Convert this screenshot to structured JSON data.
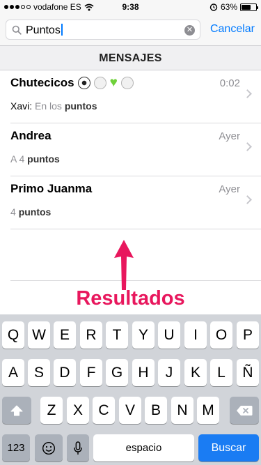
{
  "status_bar": {
    "carrier": "vodafone ES",
    "time": "9:38",
    "battery_percent": "63%",
    "battery_level": 0.63
  },
  "search": {
    "query": "Puntos",
    "cancel_label": "Cancelar"
  },
  "section": {
    "title": "MENSAJES"
  },
  "messages": [
    {
      "title": "Chutecicos",
      "time": "0:02",
      "sender": "Xavi:",
      "snippet_pre": "En los",
      "snippet_highlight": "puntos"
    },
    {
      "title": "Andrea",
      "time": "Ayer",
      "sender": "",
      "snippet_pre": "A 4",
      "snippet_highlight": "puntos"
    },
    {
      "title": "Primo Juanma",
      "time": "Ayer",
      "sender": "",
      "snippet_pre": "4",
      "snippet_highlight": "puntos"
    }
  ],
  "annotation": {
    "label": "Resultados",
    "color": "#e8175d"
  },
  "keyboard": {
    "row1": [
      "Q",
      "W",
      "E",
      "R",
      "T",
      "Y",
      "U",
      "I",
      "O",
      "P"
    ],
    "row2": [
      "A",
      "S",
      "D",
      "F",
      "G",
      "H",
      "J",
      "K",
      "L",
      "Ñ"
    ],
    "row3": [
      "Z",
      "X",
      "C",
      "V",
      "B",
      "N",
      "M"
    ],
    "numbers_label": "123",
    "space_label": "espacio",
    "search_label": "Buscar",
    "accent_color": "#1a7cf3"
  }
}
